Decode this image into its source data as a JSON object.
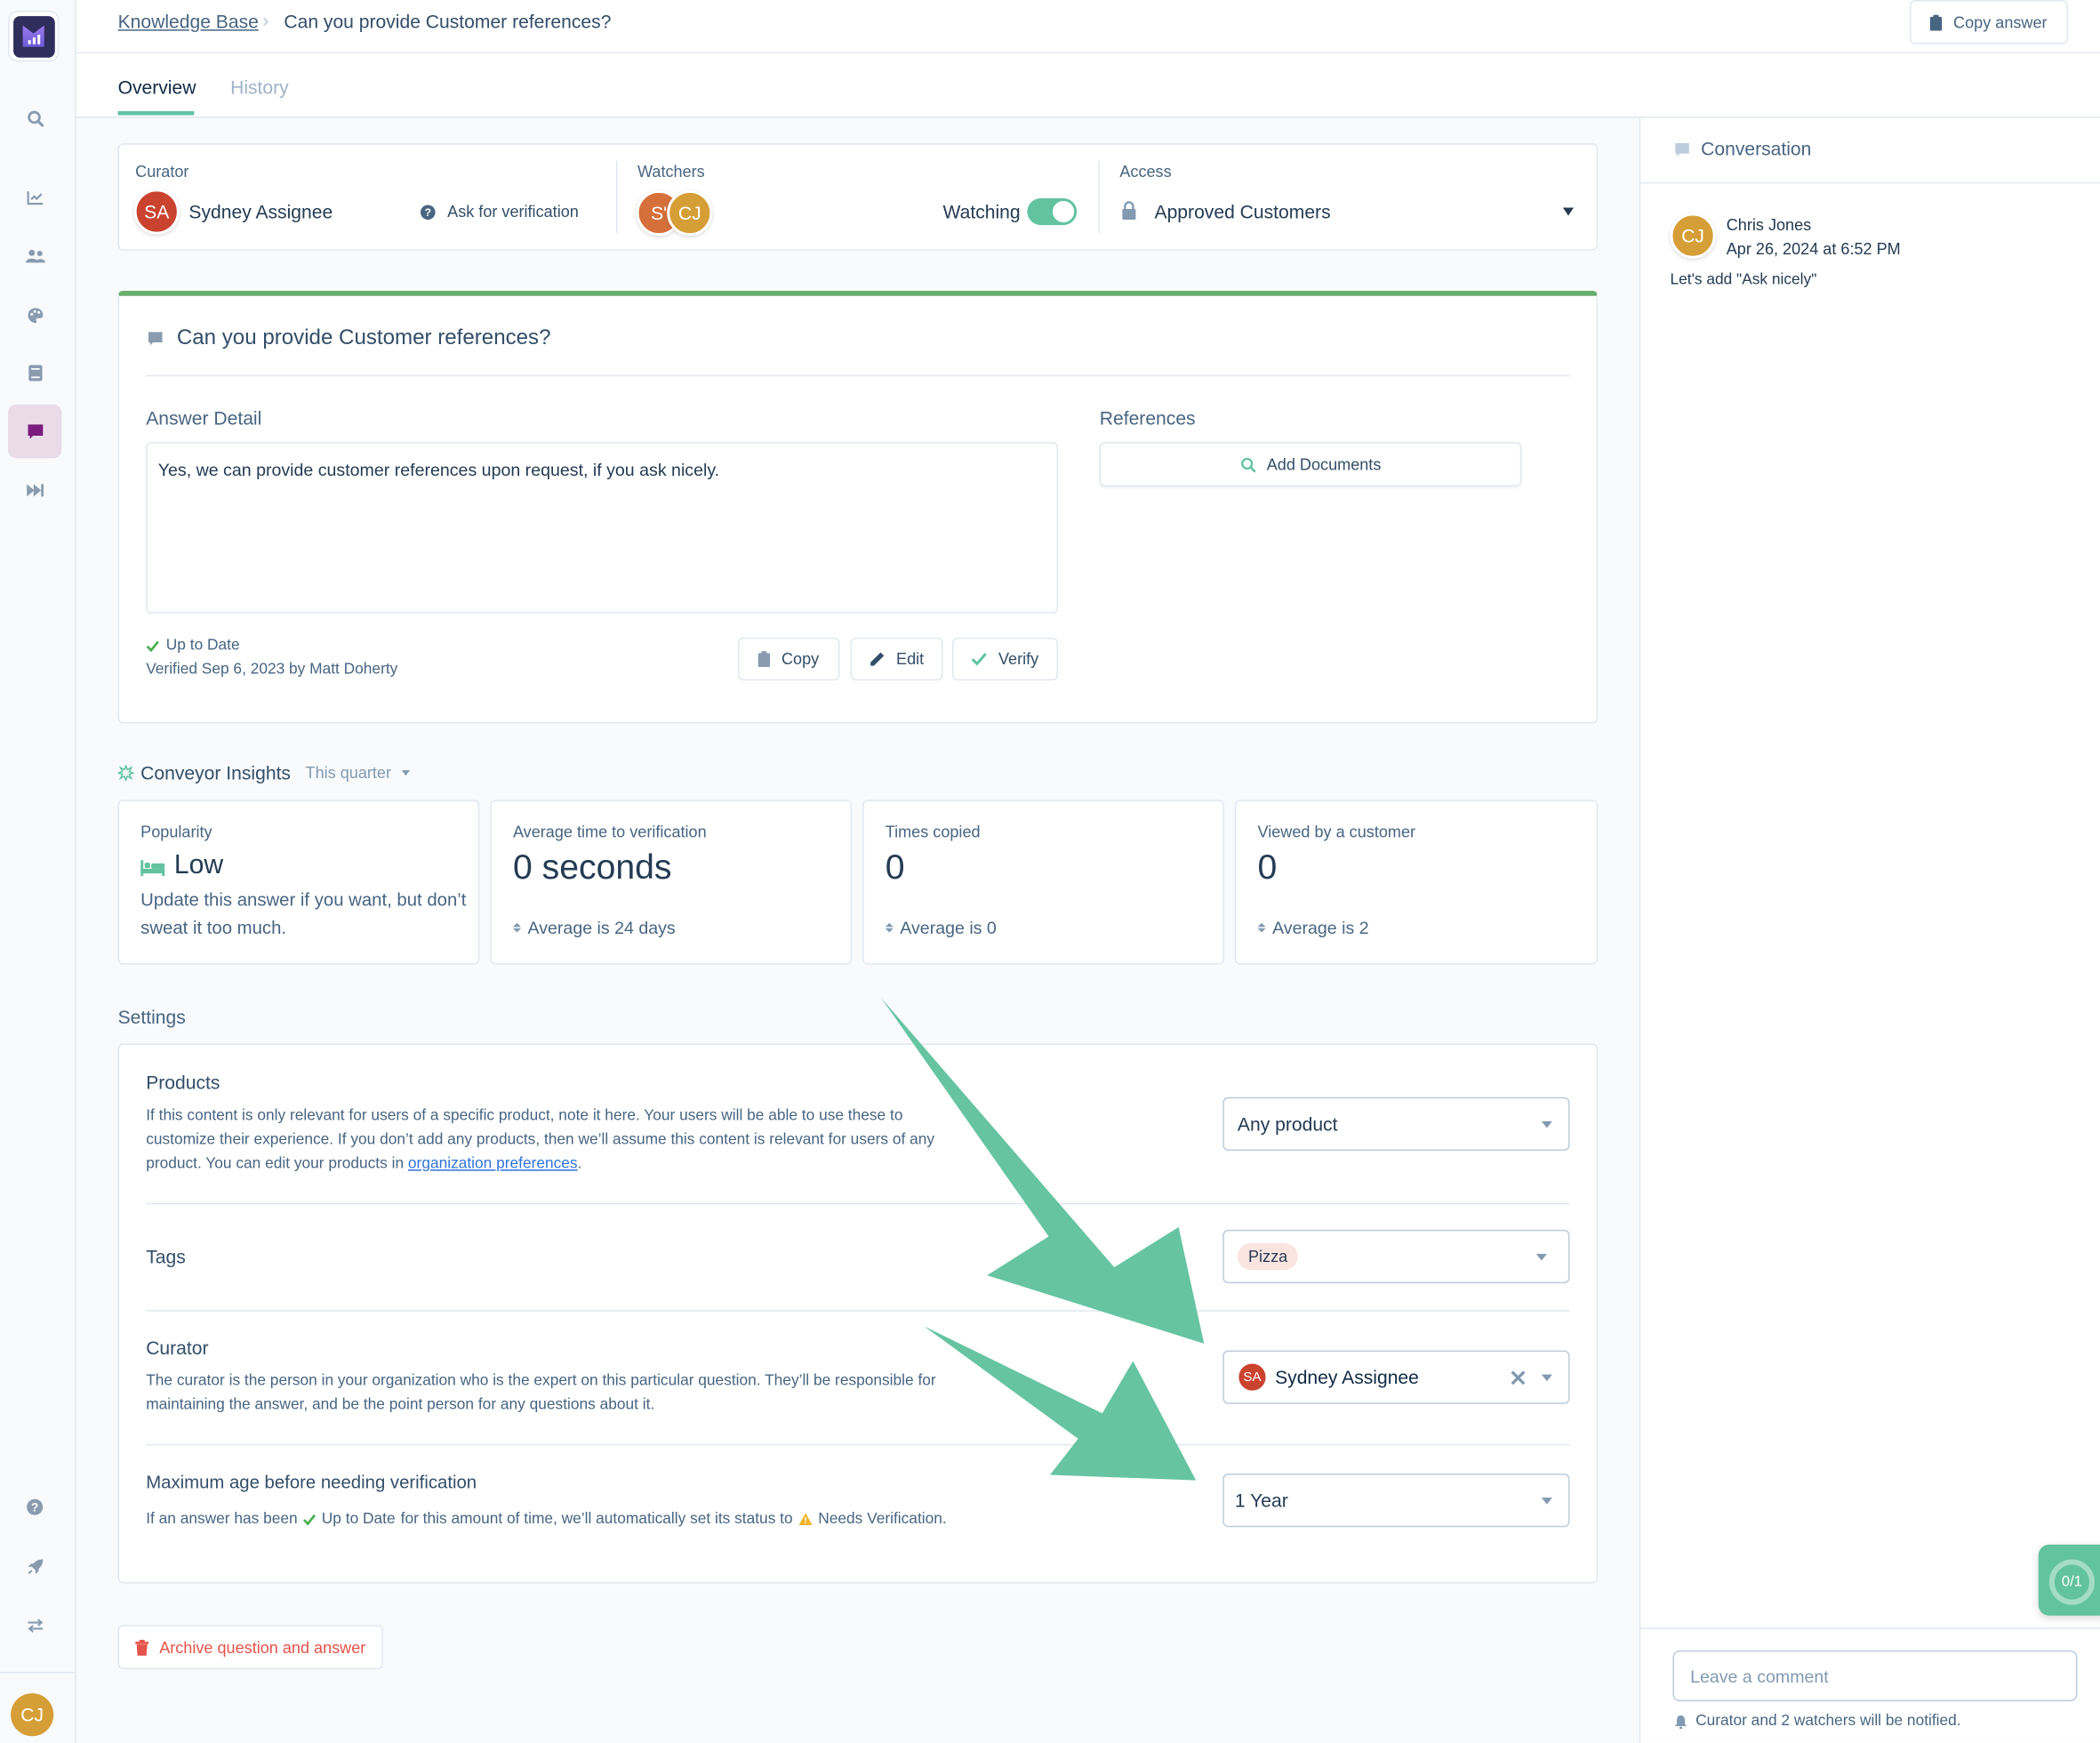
{
  "sidebar": {
    "logo": "conveyor-logo",
    "items": [
      {
        "name": "search",
        "icon": "search-icon",
        "active": false
      },
      {
        "name": "analytics",
        "icon": "chart-icon",
        "active": false
      },
      {
        "name": "users",
        "icon": "users-icon",
        "active": false
      },
      {
        "name": "branding",
        "icon": "palette-icon",
        "active": false
      },
      {
        "name": "library",
        "icon": "book-icon",
        "active": false
      },
      {
        "name": "knowledge-base",
        "icon": "comment-icon",
        "active": true
      },
      {
        "name": "fast-forward",
        "icon": "fast-forward-icon",
        "active": false
      }
    ],
    "bottom_items": [
      {
        "name": "help",
        "icon": "help-icon"
      },
      {
        "name": "launch",
        "icon": "rocket-icon"
      },
      {
        "name": "switch",
        "icon": "exchange-icon"
      }
    ],
    "user_initials": "CJ"
  },
  "header": {
    "breadcrumb_root": "Knowledge Base",
    "breadcrumb_sep": "›",
    "breadcrumb_current": "Can you provide Customer references?",
    "copy_answer_label": "Copy answer"
  },
  "tabs": [
    {
      "label": "Overview",
      "active": true
    },
    {
      "label": "History",
      "active": false
    }
  ],
  "meta": {
    "curator_label": "Curator",
    "curator_initials": "SA",
    "curator_name": "Sydney Assignee",
    "ask_verification_label": "Ask for verification",
    "watchers_label": "Watchers",
    "watchers": [
      {
        "initials": "S'"
      },
      {
        "initials": "CJ"
      }
    ],
    "watching_label": "Watching",
    "watching_on": true,
    "access_label": "Access",
    "access_value": "Approved Customers"
  },
  "question": {
    "title": "Can you provide Customer references?",
    "answer_label": "Answer Detail",
    "answer_text": "Yes, we can provide customer references upon request, if you ask nicely.",
    "references_label": "References",
    "add_documents_label": "Add Documents",
    "status": "Up to Date",
    "verified_text": "Verified Sep 6, 2023 by Matt Doherty",
    "buttons": {
      "copy": "Copy",
      "edit": "Edit",
      "verify": "Verify"
    }
  },
  "insights": {
    "title": "Conveyor Insights",
    "period": "This quarter",
    "cards": [
      {
        "title": "Popularity",
        "value": "Low",
        "desc": "Update this answer if you want, but don’t sweat it too much."
      },
      {
        "title": "Average time to verification",
        "value": "0 seconds",
        "avg": "Average is 24 days"
      },
      {
        "title": "Times copied",
        "value": "0",
        "avg": "Average is 0"
      },
      {
        "title": "Viewed by a customer",
        "value": "0",
        "avg": "Average is 2"
      }
    ]
  },
  "settings": {
    "title": "Settings",
    "products": {
      "title": "Products",
      "desc_pre": "If this content is only relevant for users of a specific product, note it here. Your users will be able to use these to customize their experience. If you don’t add any products, then we’ll assume this content is relevant for users of any product. You can edit your products in ",
      "link": "organization preferences",
      "desc_post": ".",
      "value": "Any product"
    },
    "tags": {
      "title": "Tags",
      "values": [
        "Pizza"
      ]
    },
    "curator": {
      "title": "Curator",
      "desc": "The curator is the person in your organization who is the expert on this particular question. They’ll be responsible for maintaining the answer, and be the point person for any questions about it.",
      "initials": "SA",
      "value": "Sydney Assignee"
    },
    "max_age": {
      "title": "Maximum age before needing verification",
      "desc_pre": "If an answer has been",
      "status_ok": "Up to Date",
      "desc_mid": "for this amount of time, we’ll automatically set its status to",
      "status_warn": "Needs Verification.",
      "value": "1 Year"
    }
  },
  "archive_label": "Archive question and answer",
  "conversation": {
    "title": "Conversation",
    "comments": [
      {
        "initials": "CJ",
        "author": "Chris Jones",
        "time": "Apr 26, 2024 at 6:52 PM",
        "text": "Let's add \"Ask nicely\""
      }
    ],
    "comment_placeholder": "Leave a comment",
    "notify_text": "Curator and 2 watchers will be notified."
  },
  "progress_widget": {
    "label": "0/1",
    "completed": 0,
    "total": 1
  },
  "colors": {
    "accent": "#62c3a0",
    "verified_border": "#6aaf6e",
    "curator_avatar": "#c9432f",
    "watcher_avatar_1": "#d6703a",
    "watcher_avatar_2": "#d69e36",
    "active_nav": "#7b1c7e",
    "danger": "#e5544a",
    "tag_bg": "#fbe3e0",
    "annotation_arrow": "#66c4a2"
  }
}
